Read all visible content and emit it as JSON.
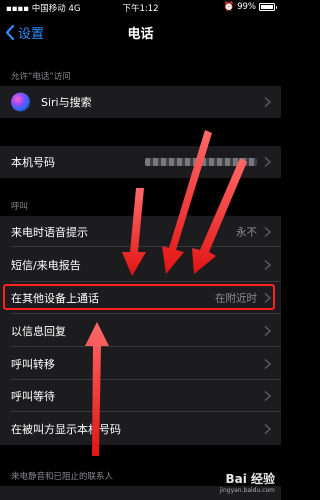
{
  "status_bar": {
    "carrier": "中国移动",
    "network": "4G",
    "time": "下午1:12",
    "battery": "99%"
  },
  "nav": {
    "back_label": "设置",
    "title": "电话"
  },
  "sections": {
    "allow_access_header": "允许“电话”访问",
    "call_header": "呼叫",
    "bottom_header": "来电静音和已阻止的联系人"
  },
  "rows": {
    "siri": {
      "label": "Siri与搜索"
    },
    "my_number": {
      "label": "本机号码"
    },
    "announce_calls": {
      "label": "来电时语音提示",
      "value": "永不"
    },
    "sms_reports": {
      "label": "短信/来电报告"
    },
    "other_devices": {
      "label": "在其他设备上通话",
      "value": "在附近时"
    },
    "respond_with_text": {
      "label": "以信息回复"
    },
    "call_forwarding": {
      "label": "呼叫转移"
    },
    "call_waiting": {
      "label": "呼叫等待"
    },
    "show_caller_id": {
      "label": "在被叫方显示本机号码"
    }
  },
  "watermark": {
    "brand": "Bai 经验",
    "url": "jingyan.baidu.com"
  },
  "colors": {
    "accent": "#2f8cff",
    "highlight": "#ff2020",
    "cell": "#1c1c1e"
  }
}
